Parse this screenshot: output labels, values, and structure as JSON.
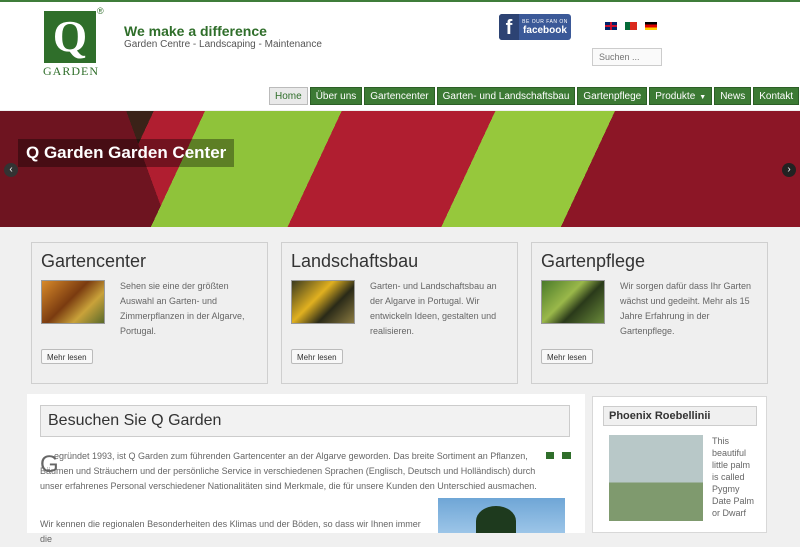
{
  "header": {
    "logo_letter": "Q",
    "logo_registered": "®",
    "logo_word": "GARDEN",
    "slogan": "We make a difference",
    "tagline": "Garden Centre - Landscaping - Maintenance",
    "facebook_small": "BE OUR FAN ON",
    "facebook_big": "facebook",
    "search_placeholder": "Suchen ..."
  },
  "nav": {
    "items": [
      {
        "label": "Home"
      },
      {
        "label": "Über uns"
      },
      {
        "label": "Gartencenter"
      },
      {
        "label": "Garten- und Landschaftsbau"
      },
      {
        "label": "Gartenpflege"
      },
      {
        "label": "Produkte"
      },
      {
        "label": "News"
      },
      {
        "label": "Kontakt"
      }
    ],
    "active": "Home"
  },
  "banner": {
    "title": "Q Garden Garden Center",
    "prev": "‹",
    "next": "›"
  },
  "features": [
    {
      "title": "Gartencenter",
      "text": "Sehen sie eine der größten Auswahl an Garten- und Zimmerpflanzen in der Algarve, Portugal.",
      "button": "Mehr lesen"
    },
    {
      "title": "Landschaftsbau",
      "text": "Garten- und Landschaftsbau an der Algarve in Portugal. Wir entwickeln Ideen, gestalten und realisieren.",
      "button": "Mehr lesen"
    },
    {
      "title": "Gartenpflege",
      "text": "Wir sorgen dafür dass Ihr Garten wächst und gedeiht. Mehr als 15 Jahre Erfahrung in der Gartenpflege.",
      "button": "Mehr lesen"
    }
  ],
  "content": {
    "title": "Besuchen Sie Q Garden",
    "dropcap": "G",
    "para1": "egründet 1993, ist Q Garden zum führenden Gartencenter an der Algarve geworden. Das breite Sortiment an Pflanzen, Bäumen und Sträuchern und der persönliche Service in verschiedenen Sprachen (Englisch, Deutsch und Holländisch) durch unser erfahrenes Personal verschiedener Nationalitäten sind Merkmale, die für unsere Kunden den Unterschied ausmachen.",
    "para2": "Wir kennen die regionalen Besonderheiten des Klimas und der Böden, so dass wir Ihnen immer die"
  },
  "sidebar": {
    "title": "Phoenix Roebellinii",
    "text": "This beautiful little palm is called Pygmy Date Palm or Dwarf"
  },
  "colors": {
    "brand_green": "#2f6e2a",
    "nav_green": "#3c7a34",
    "facebook_blue": "#3b5998"
  }
}
